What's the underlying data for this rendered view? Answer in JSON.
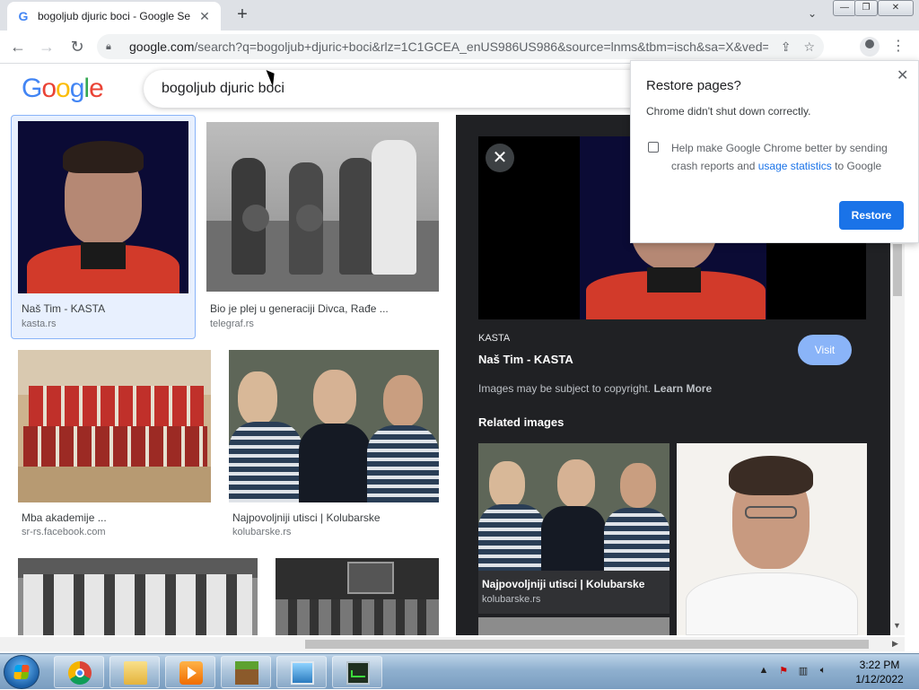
{
  "browser": {
    "tab_title": "bogoljub djuric boci - Google Se",
    "favicon": "G",
    "new_tab": "+",
    "url_host": "google.com",
    "url_rest": "/search?q=bogoljub+djuric+boci&rlz=1C1GCEA_enUS986US986&source=lnms&tbm=isch&sa=X&ved=2..."
  },
  "google": {
    "logo": "Google",
    "query": "bogoljub djuric boci"
  },
  "results": [
    {
      "caption": "Naš Tim - KASTA",
      "source": "kasta.rs"
    },
    {
      "caption": "Bio je plej u generaciji Divca, Rađe ...",
      "source": "telegraf.rs"
    },
    {
      "caption": "Mba akademije ...",
      "source": "sr-rs.facebook.com"
    },
    {
      "caption": "Najpovoljniji utisci | Kolubarske",
      "source": "kolubarske.rs"
    }
  ],
  "preview": {
    "source": "KASTA",
    "title": "Naš Tim - KASTA",
    "visit": "Visit",
    "copyright": "Images may be subject to copyright.",
    "learn_more": "Learn More",
    "related_heading": "Related images",
    "related": [
      {
        "caption": "Najpovoljniji utisci | Kolubarske",
        "source": "kolubarske.rs"
      }
    ]
  },
  "restore_popup": {
    "title": "Restore pages?",
    "subtitle": "Chrome didn't shut down correctly.",
    "checkbox_text_1": "Help make Google Chrome better by sending crash reports and",
    "checkbox_link": "usage statistics",
    "checkbox_text_2": "to Google",
    "button": "Restore"
  },
  "taskbar": {
    "time": "3:22 PM",
    "date": "1/12/2022",
    "items": [
      "chrome",
      "file-explorer",
      "media-player",
      "minecraft",
      "photo-viewer",
      "task-manager"
    ]
  },
  "colors": {
    "accent": "#1a73e8",
    "preview_bg": "#202124",
    "visit_btn": "#8ab4f8",
    "google_blue": "#4285F4",
    "google_red": "#EA4335",
    "google_yellow": "#FBBC05",
    "google_green": "#34A853"
  }
}
